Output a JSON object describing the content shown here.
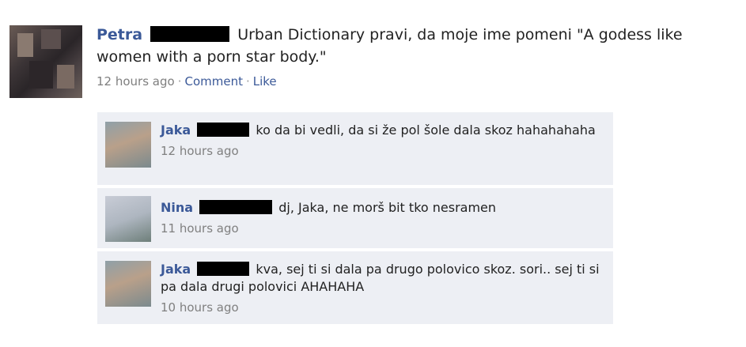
{
  "post": {
    "author": "Petra",
    "text": "Urban Dictionary pravi, da moje ime pomeni \"A godess like women with a porn star body.\"",
    "time": "12 hours ago",
    "separator": "·",
    "comment_label": "Comment",
    "like_label": "Like"
  },
  "comments": [
    {
      "author": "Jaka",
      "text": "ko da bi vedli, da si že pol šole dala skoz hahahahaha",
      "time": "12 hours ago"
    },
    {
      "author": "Nina",
      "text": "dj, Jaka, ne morš bit tko nesramen",
      "time": "11 hours ago"
    },
    {
      "author": "Jaka",
      "text": "kva, sej ti si dala pa drugo polovico skoz. sori.. sej ti si pa dala drugi polovici AHAHAHA",
      "time": "10 hours ago"
    }
  ],
  "colors": {
    "link": "#3b5998",
    "comment_bg": "#edeff4",
    "redaction": "#000000"
  }
}
